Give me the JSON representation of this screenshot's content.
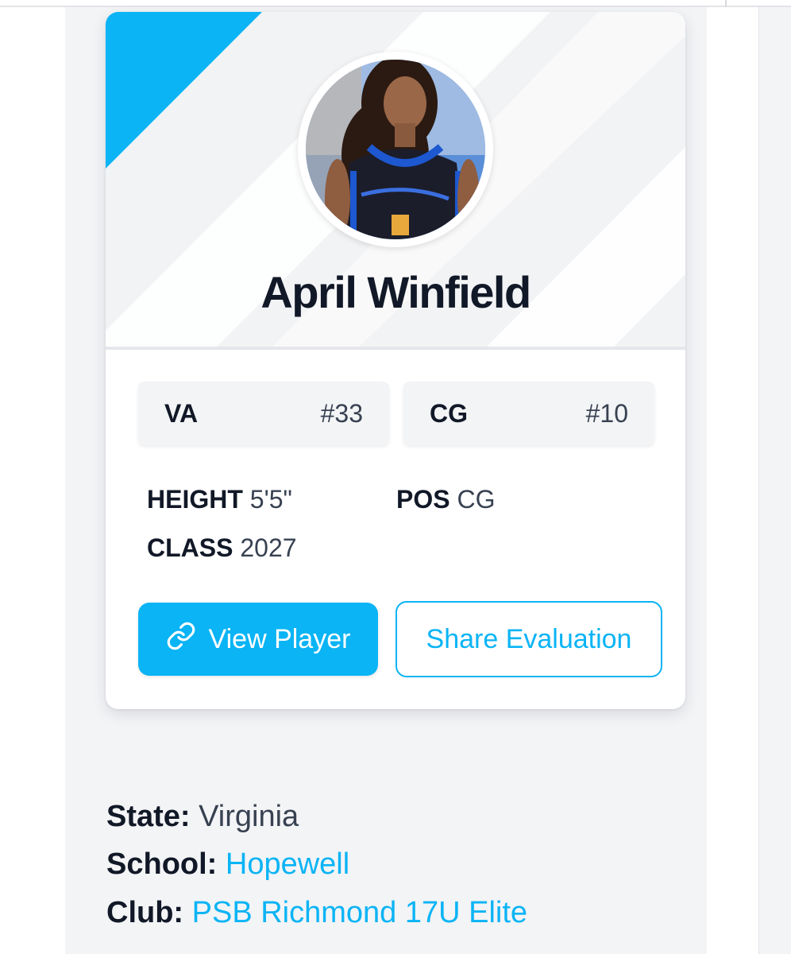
{
  "player": {
    "name": "April Winfield",
    "photo_alt": "April Winfield"
  },
  "rankings": [
    {
      "label": "VA",
      "value": "#33"
    },
    {
      "label": "CG",
      "value": "#10"
    }
  ],
  "stats": {
    "height_label": "HEIGHT",
    "height_value": "5'5\"",
    "pos_label": "POS",
    "pos_value": "CG",
    "class_label": "CLASS",
    "class_value": "2027"
  },
  "buttons": {
    "view_player": "View Player",
    "share_evaluation": "Share Evaluation",
    "view_player_icon": "link-icon"
  },
  "info": {
    "state_label": "State:",
    "state_value": "Virginia",
    "school_label": "School:",
    "school_value": "Hopewell",
    "club_label": "Club:",
    "club_value": "PSB Richmond 17U Elite"
  },
  "colors": {
    "accent": "#0ab4f5",
    "text_dark": "#111827",
    "text_muted": "#374151",
    "page_bg": "#f3f4f6"
  }
}
